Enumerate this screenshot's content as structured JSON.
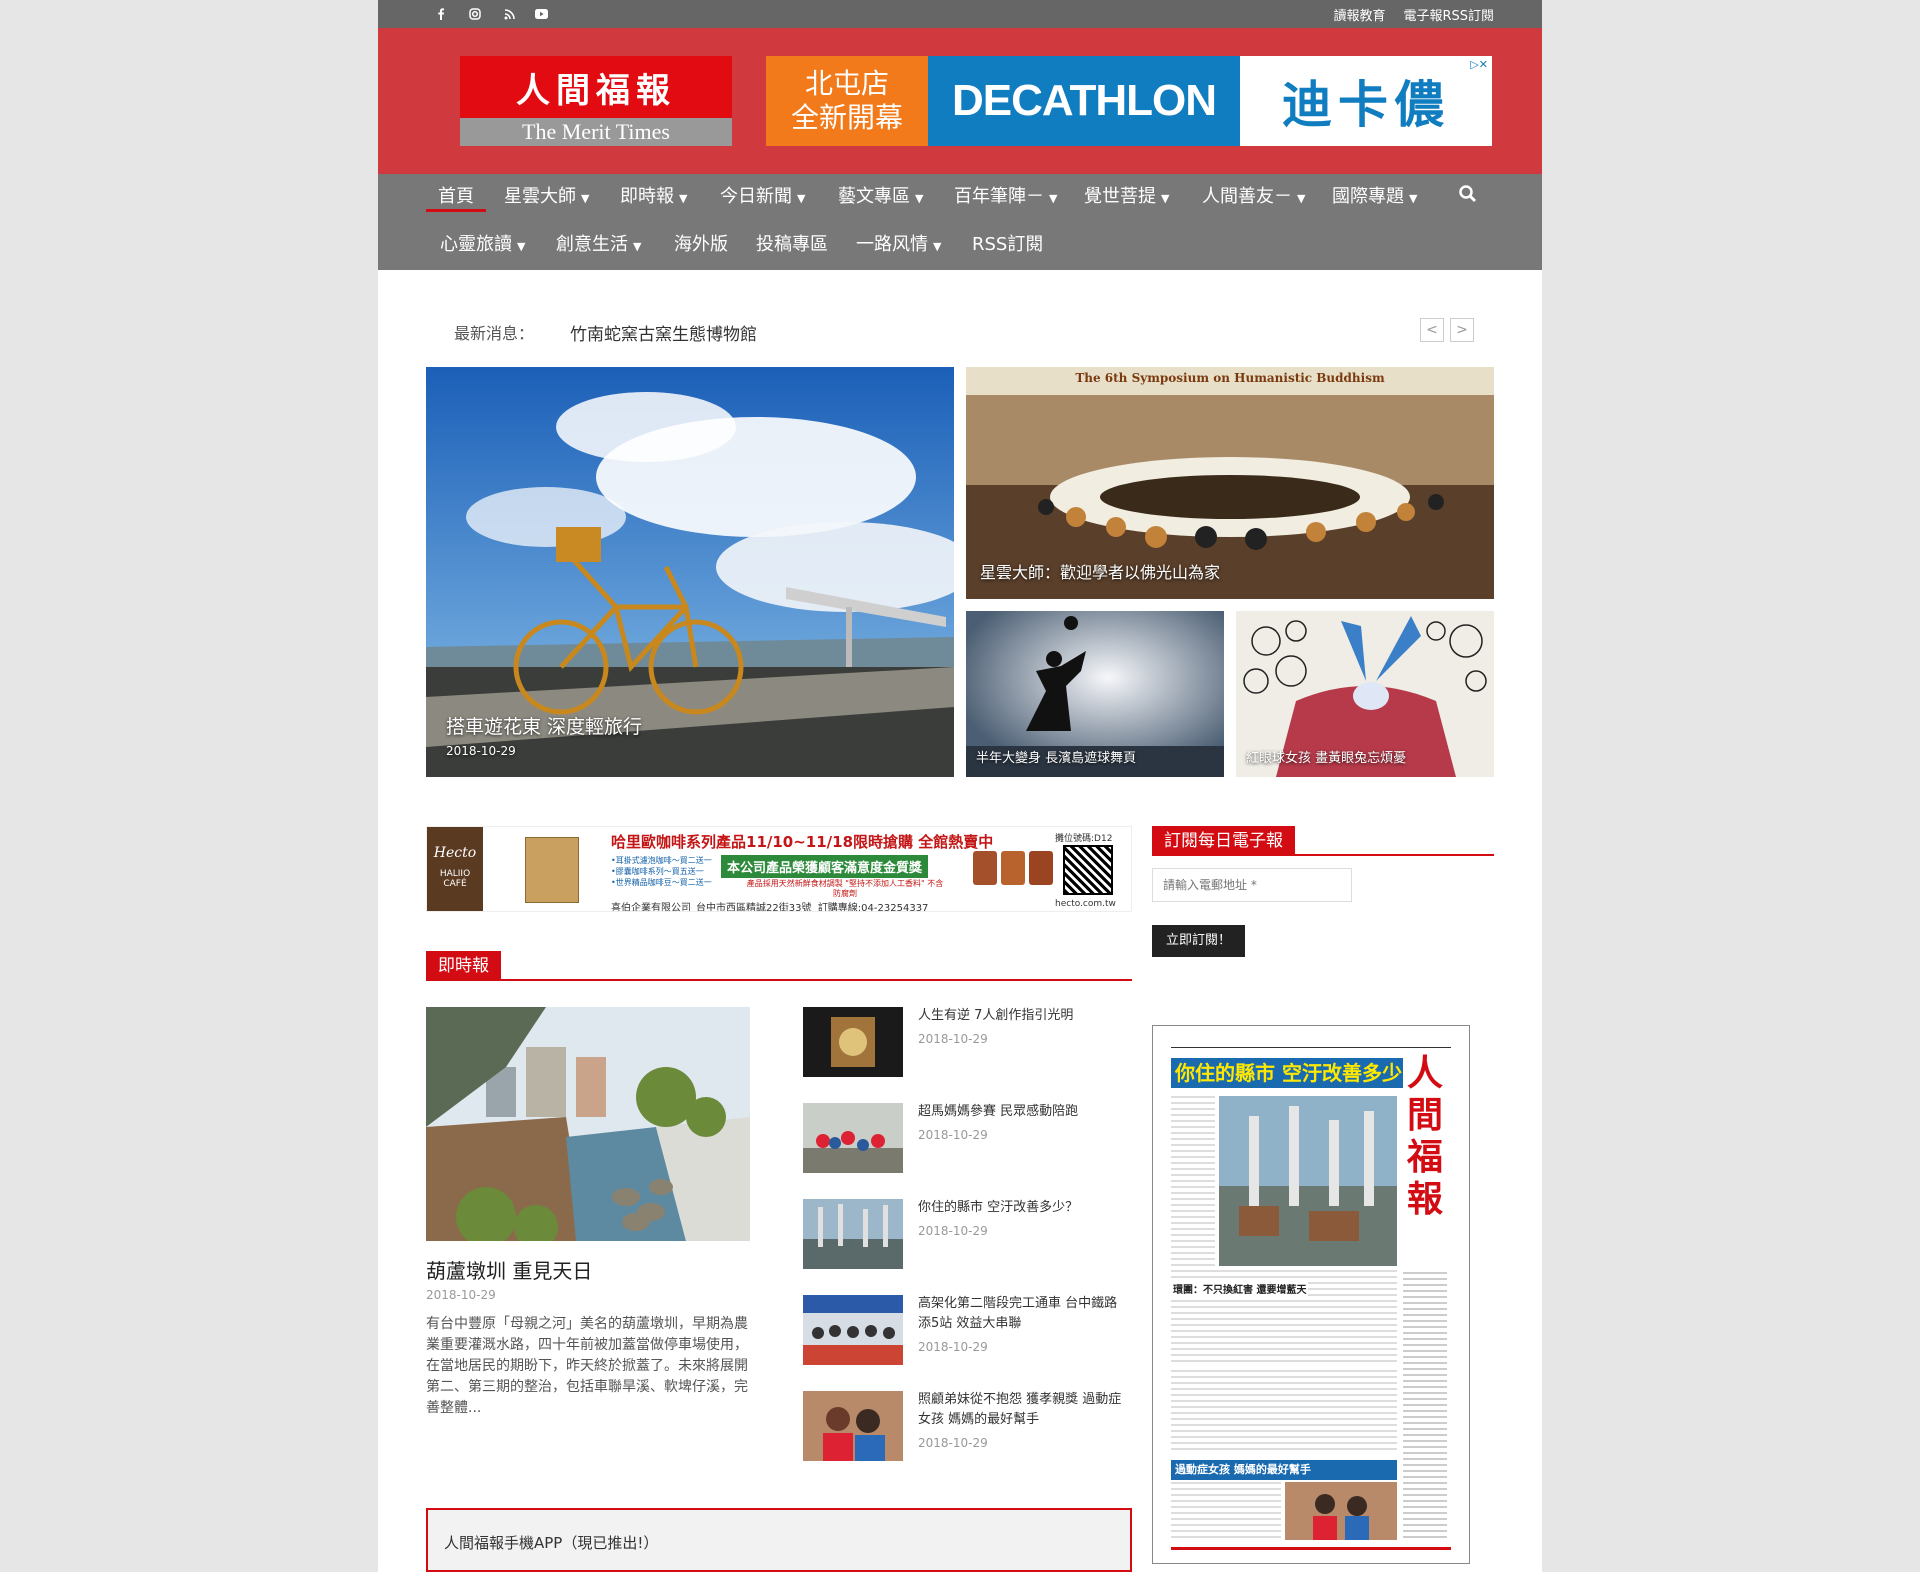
{
  "topbar": {
    "social_icons": [
      "facebook-icon",
      "instagram-icon",
      "rss-icon",
      "youtube-icon"
    ],
    "links": [
      "讀報教育",
      "電子報RSS訂閱"
    ]
  },
  "logo": {
    "chinese": "人間福報",
    "english": "The Merit Times"
  },
  "banner_ad": {
    "store": "北屯店 全新開幕",
    "brand": "DECATHLON",
    "brand_cn": "迪卡儂"
  },
  "nav": {
    "row1": [
      "首頁",
      "星雲大師",
      "即時報",
      "今日新聞",
      "藝文專區",
      "百年筆陣－",
      "覺世菩提",
      "人間善友－",
      "國際專題"
    ],
    "row2": [
      "心靈旅讀",
      "創意生活",
      "海外版",
      "投稿專區",
      "一路风情",
      "RSS訂閱"
    ]
  },
  "ticker": {
    "label": "最新消息：",
    "text": "竹南蛇窯古窯生態博物館"
  },
  "featured": {
    "main": {
      "title": "搭車遊花東 深度輕旅行",
      "date": "2018-10-29"
    },
    "top_right": {
      "title": "星雲大師：歡迎學者以佛光山為家",
      "banner": "The 6th Symposium on Humanistic Buddhism"
    },
    "bottom_left": {
      "title": "半年大變身 長濱島遮球舞頁"
    },
    "bottom_right": {
      "title": "紅眼球女孩 畫黃眼兔忘煩憂"
    }
  },
  "hecto_ad": {
    "brand": "Hecto",
    "cafe": "HALIIO CAFÉ",
    "headline": "哈里歐咖啡系列產品11/10~11/18限時搶購 全館熱賣中",
    "bullets": [
      "•耳掛式濾泡咖啡～買二送一",
      "•膠囊咖啡系列～買五送一",
      "•世界精品咖啡豆～買二送一"
    ],
    "award": "本公司產品榮獲顧客滿意度金質獎",
    "note": "產品採用天然新鮮食材調製 \"堅持不添加人工香料\" 不含防腐劑",
    "company": "喜伯企業有限公司_台中市西區精誠22街33號",
    "phone": "訂購專線:04-23254337",
    "booth": "攤位號碼:D12",
    "url": "hecto.com.tw"
  },
  "instant_news": {
    "heading": "即時報",
    "main": {
      "title": "葫蘆墩圳 重見天日",
      "date": "2018-10-29",
      "excerpt": "有台中豐原「母親之河」美名的葫蘆墩圳，早期為農業重要灌溉水路，四十年前被加蓋當做停車場使用，在當地居民的期盼下，昨天終於掀蓋了。未來將展開第二、第三期的整治，包括車聯旱溪、軟埤仔溪，完善整體..."
    },
    "list": [
      {
        "title": "人生有逆 7人創作指引光明",
        "date": "2018-10-29"
      },
      {
        "title": "超馬媽媽參賽 民眾感動陪跑",
        "date": "2018-10-29"
      },
      {
        "title": "你住的縣市 空汙改善多少？",
        "date": "2018-10-29"
      },
      {
        "title": "高架化第二階段完工通車 台中鐵路添5站 效益大串聯",
        "date": "2018-10-29"
      },
      {
        "title": "照顧弟妹從不抱怨 獲孝親獎 過動症女孩 媽媽的最好幫手",
        "date": "2018-10-29"
      }
    ]
  },
  "subscribe": {
    "heading": "訂閱每日電子報",
    "placeholder": "請輸入電郵地址 *",
    "button": "立即訂閱！"
  },
  "newspaper": {
    "headline": "你住的縣市 空汙改善多少?",
    "masthead": "人間福報",
    "sub_headline": "過動症女孩 媽媽的最好幫手",
    "mid_headline": "環團：不只換紅害 還要增藍天"
  },
  "app_box": {
    "text": "人間福報手機APP（現已推出!）"
  },
  "colors": {
    "brand_red": "#d03a3e",
    "accent_red": "#d20c12",
    "nav_gray": "#787878",
    "topbar_gray": "#666666"
  }
}
